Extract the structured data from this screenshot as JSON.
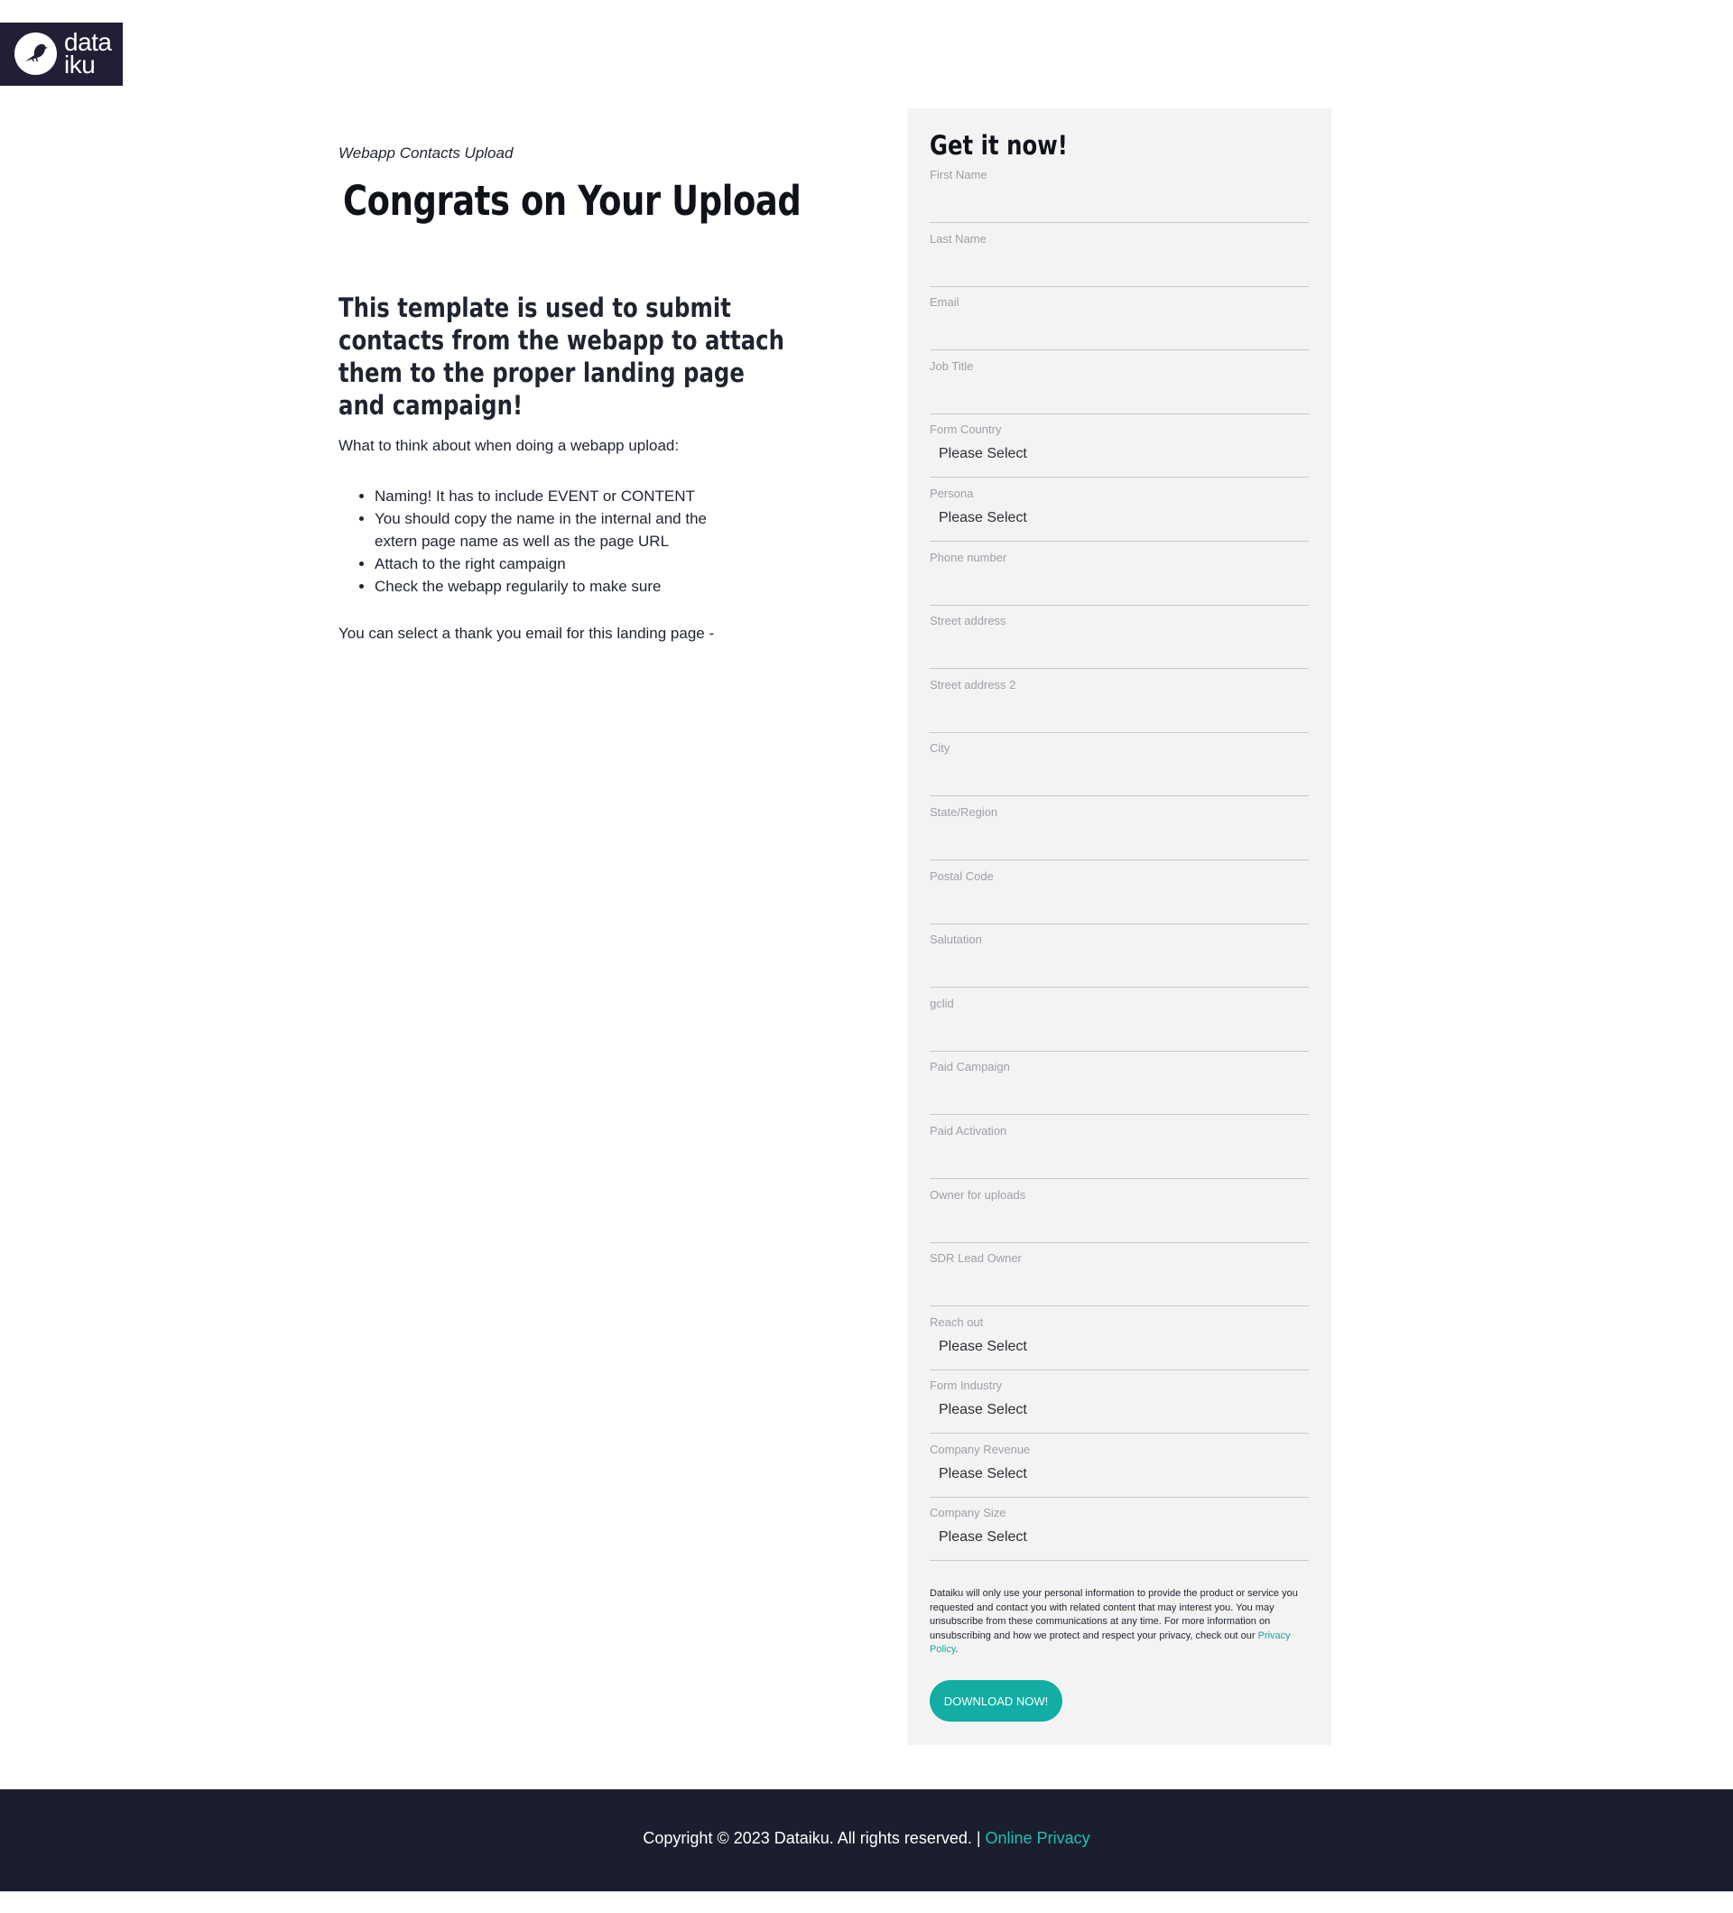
{
  "brand": {
    "logo_line1": "data",
    "logo_line2": "iku",
    "logo_icon": "bird-icon"
  },
  "intro": {
    "eyebrow": "Webapp Contacts Upload",
    "title": "Congrats on Your Upload",
    "subheading": "This template is used to submit contacts from the webapp to attach them to the proper landing page and campaign!",
    "lead": "What to think about when doing a webapp upload:",
    "bullets": [
      "Naming! It has to include EVENT or CONTENT",
      "You should copy the name in the internal and the extern page name as well as the page URL",
      "Attach to the right campaign",
      "Check the webapp regularily to make sure"
    ],
    "closing": "You can select a thank you email for this landing page -"
  },
  "form": {
    "title": "Get it now!",
    "fields": [
      {
        "label": "First Name",
        "value": ""
      },
      {
        "label": "Last Name",
        "value": ""
      },
      {
        "label": "Email",
        "value": ""
      },
      {
        "label": "Job Title",
        "value": ""
      },
      {
        "label": "Form Country",
        "value": "Please Select"
      },
      {
        "label": "Persona",
        "value": "Please Select"
      },
      {
        "label": "Phone number",
        "value": ""
      },
      {
        "label": "Street address",
        "value": ""
      },
      {
        "label": "Street address 2",
        "value": ""
      },
      {
        "label": "City",
        "value": ""
      },
      {
        "label": "State/Region",
        "value": ""
      },
      {
        "label": "Postal Code",
        "value": ""
      },
      {
        "label": "Salutation",
        "value": ""
      },
      {
        "label": "gclid",
        "value": ""
      },
      {
        "label": "Paid Campaign",
        "value": ""
      },
      {
        "label": "Paid Activation",
        "value": ""
      },
      {
        "label": "Owner for uploads",
        "value": ""
      },
      {
        "label": "SDR Lead Owner",
        "value": ""
      },
      {
        "label": "Reach out",
        "value": "Please Select"
      },
      {
        "label": "Form Industry",
        "value": "Please Select"
      },
      {
        "label": "Company Revenue",
        "value": "Please Select"
      },
      {
        "label": "Company Size",
        "value": "Please Select"
      }
    ],
    "consent_text": "Dataiku will only use your personal information to provide the product or service you requested and contact you with related content that may interest you. You may unsubscribe from these communications at any time. For more information on unsubscribing and how we protect and respect your privacy, check out our ",
    "consent_link": "Privacy Policy",
    "consent_end": ".",
    "submit_label": "DOWNLOAD NOW!"
  },
  "footer": {
    "copyright": "Copyright © 2023 Dataiku. All rights reserved. | ",
    "privacy_link": "Online Privacy"
  },
  "colors": {
    "accent": "#12ada4",
    "logo_bg": "#221e35",
    "footer_bg": "#1b1f2d",
    "panel_bg": "#f3f3f3"
  }
}
